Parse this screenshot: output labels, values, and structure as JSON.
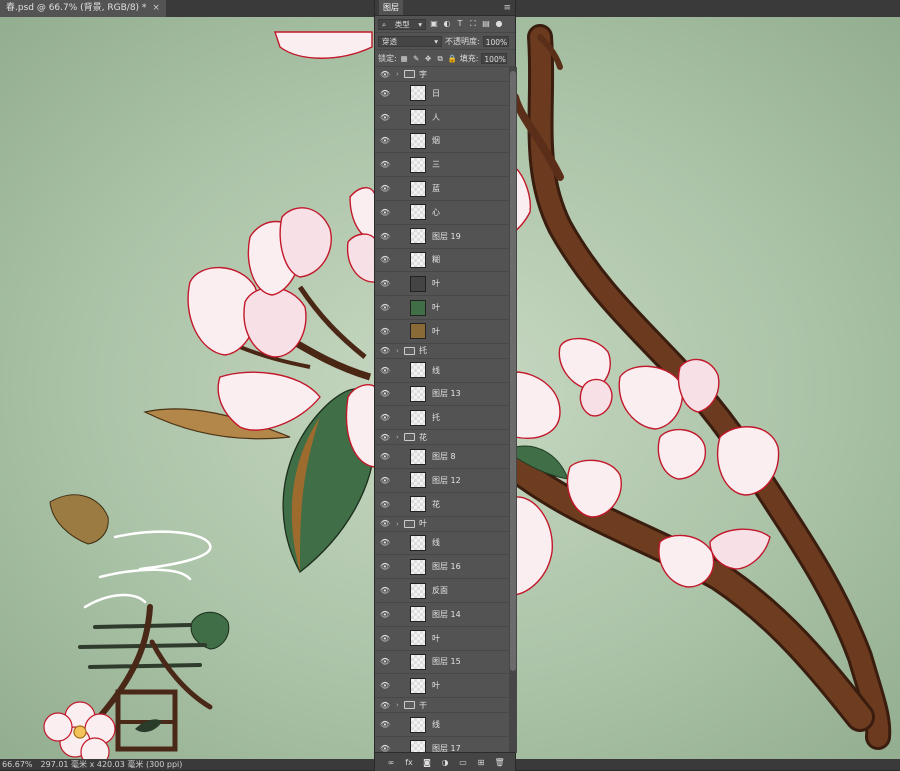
{
  "document": {
    "tab_title": "春.psd @ 66.7% (背景, RGB/8) *",
    "close_symbol": "×"
  },
  "status": {
    "zoom": "66.67%",
    "doc_size": "297.01 毫米 x 420.03 毫米 (300 ppi)"
  },
  "panel": {
    "tab_label": "图层",
    "menu_icon": "hamburger-icon",
    "filter": {
      "kind_label": "类型",
      "icons": [
        "image-icon",
        "adjustment-icon",
        "type-icon",
        "shape-icon",
        "smart-object-icon"
      ]
    },
    "blend_mode": "穿透",
    "opacity_label": "不透明度:",
    "opacity_value": "100%",
    "lock_label": "锁定:",
    "fill_label": "填充:",
    "fill_value": "100%",
    "footer_icons": [
      "link-icon",
      "fx-icon",
      "mask-icon",
      "adjustment-icon",
      "folder-icon",
      "new-layer-icon",
      "trash-icon"
    ]
  },
  "layers": [
    {
      "type": "group",
      "name": "字"
    },
    {
      "type": "layer",
      "name": "日",
      "thumb": "char"
    },
    {
      "type": "layer",
      "name": "人",
      "thumb": "char"
    },
    {
      "type": "layer",
      "name": "烟",
      "thumb": "plain"
    },
    {
      "type": "layer",
      "name": "三",
      "thumb": "lines"
    },
    {
      "type": "layer",
      "name": "蓝",
      "thumb": "plain"
    },
    {
      "type": "layer",
      "name": "心",
      "thumb": "plain"
    },
    {
      "type": "layer",
      "name": "图层 19",
      "thumb": "plain"
    },
    {
      "type": "layer",
      "name": "糊",
      "thumb": "plain"
    },
    {
      "type": "layer",
      "name": "叶",
      "thumb": "leaf-dark"
    },
    {
      "type": "layer",
      "name": "叶",
      "thumb": "leaf-green"
    },
    {
      "type": "layer",
      "name": "叶",
      "thumb": "leaf-brown"
    },
    {
      "type": "group",
      "name": "托"
    },
    {
      "type": "layer",
      "name": "线",
      "thumb": "plain"
    },
    {
      "type": "layer",
      "name": "图层 13",
      "thumb": "plain"
    },
    {
      "type": "layer",
      "name": "托",
      "thumb": "plain"
    },
    {
      "type": "group",
      "name": "花"
    },
    {
      "type": "layer",
      "name": "图层 8",
      "thumb": "plain"
    },
    {
      "type": "layer",
      "name": "图层 12",
      "thumb": "plain"
    },
    {
      "type": "layer",
      "name": "花",
      "thumb": "plain"
    },
    {
      "type": "group",
      "name": "叶"
    },
    {
      "type": "layer",
      "name": "线",
      "thumb": "plain"
    },
    {
      "type": "layer",
      "name": "图层 16",
      "thumb": "plain"
    },
    {
      "type": "layer",
      "name": "反面",
      "thumb": "plain"
    },
    {
      "type": "layer",
      "name": "图层 14",
      "thumb": "plain"
    },
    {
      "type": "layer",
      "name": "叶",
      "thumb": "plain"
    },
    {
      "type": "layer",
      "name": "图层 15",
      "thumb": "plain"
    },
    {
      "type": "layer",
      "name": "叶",
      "thumb": "plain"
    },
    {
      "type": "group",
      "name": "干"
    },
    {
      "type": "layer",
      "name": "线",
      "thumb": "plain"
    },
    {
      "type": "layer",
      "name": "图层 17",
      "thumb": "plain"
    }
  ],
  "artwork": {
    "calligraphy_char": "春",
    "colors": {
      "bg": "#b4c9b0",
      "petal_edge": "#c2182b",
      "petal": "#fbeef0",
      "branch": "#5a2e18",
      "leaf": "#3f6e47",
      "leaf_brown": "#8a6a36"
    }
  }
}
